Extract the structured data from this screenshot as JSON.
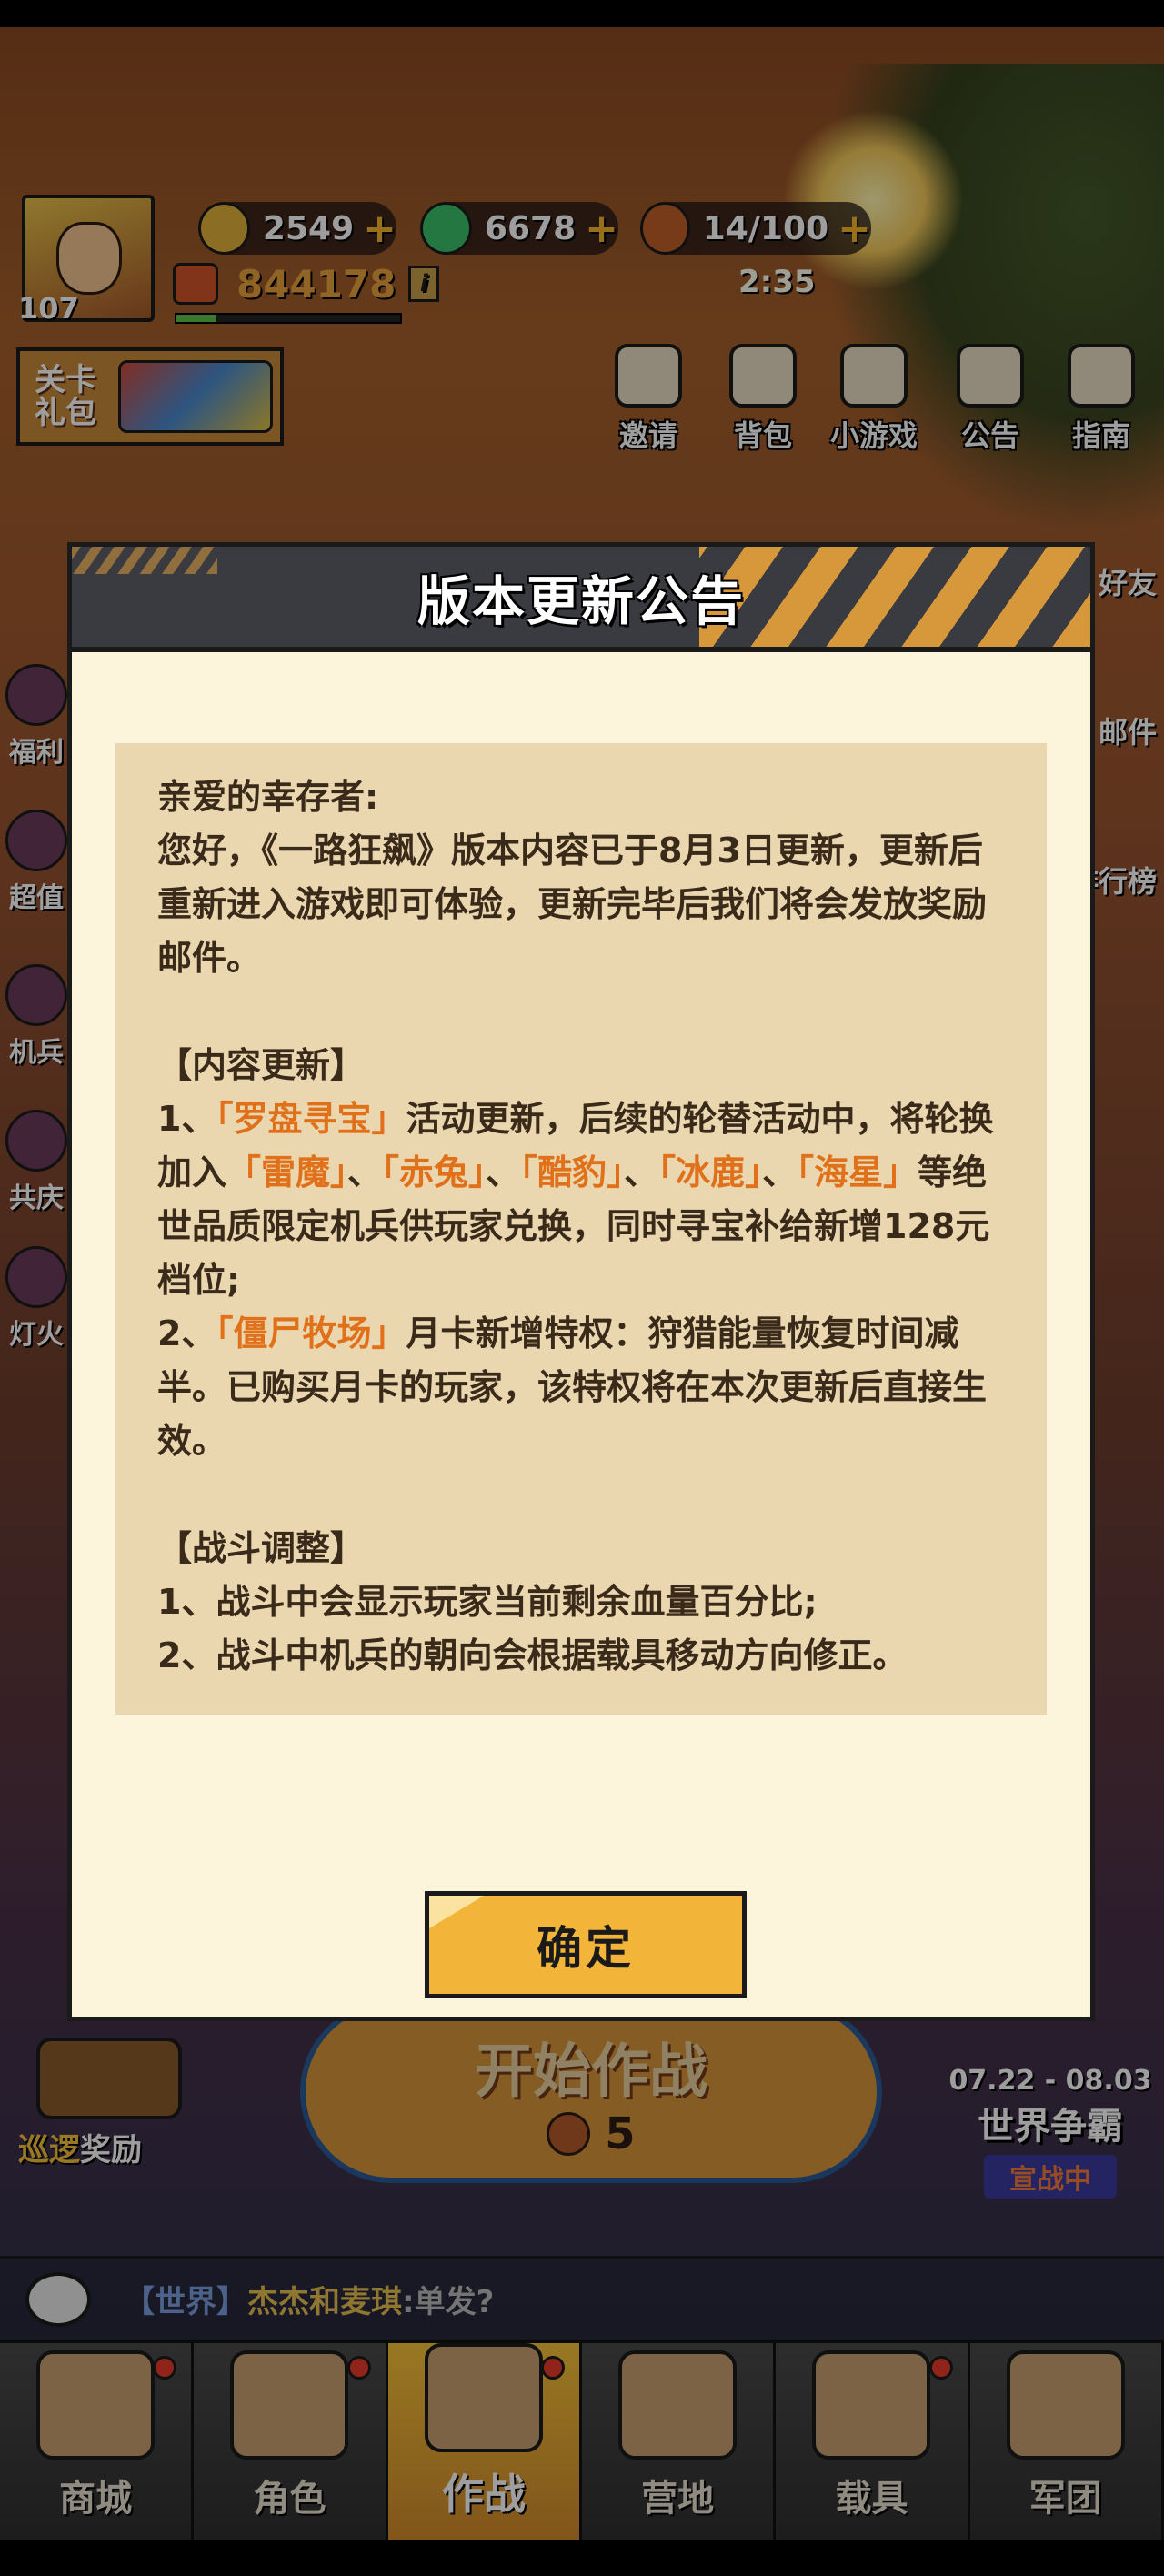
{
  "hud": {
    "level": "107",
    "coins": "2549",
    "gems": "6678",
    "stamina": "14/100",
    "stamina_timer": "2:35",
    "power": "844178",
    "power_info": "i",
    "pack_label": "关卡礼包"
  },
  "top_menu": [
    {
      "label": "邀请"
    },
    {
      "label": "背包"
    },
    {
      "label": "小游戏"
    },
    {
      "label": "公告"
    },
    {
      "label": "指南"
    }
  ],
  "side_left": [
    {
      "label": "福利"
    },
    {
      "label": "超值"
    },
    {
      "label": "机兵"
    },
    {
      "label": "共庆"
    },
    {
      "label": "灯火"
    }
  ],
  "side_right": [
    {
      "label": "好友"
    },
    {
      "label": "邮件"
    },
    {
      "label": "排行榜"
    }
  ],
  "start": {
    "label": "开始作战",
    "cost": "5"
  },
  "patrol": {
    "label": "巡逻",
    "label_sub": "奖励"
  },
  "world_event": {
    "date_range": "07.22 - 08.03",
    "title": "世界争霸",
    "status": "宣战中"
  },
  "chat": {
    "channel": "【世界】",
    "name": "杰杰和麦琪",
    "message": ":单发?"
  },
  "nav": [
    {
      "label": "商城",
      "badge": true
    },
    {
      "label": "角色",
      "badge": true
    },
    {
      "label": "作战",
      "badge": true,
      "active": true
    },
    {
      "label": "营地",
      "badge": false
    },
    {
      "label": "载具",
      "badge": true
    },
    {
      "label": "军团",
      "badge": false
    }
  ],
  "dialog": {
    "title": "版本更新公告",
    "greeting": "亲爱的幸存者:",
    "intro": "您好，《一路狂飙》版本内容已于8月3日更新，更新后重新进入游戏即可体验，更新完毕后我们将会发放奖励邮件。",
    "section1_title": "【内容更新】",
    "item1_prefix": "1、",
    "item1_hl1": "「罗盘寻宝」",
    "item1_text1": "活动更新，后续的轮替活动中，将轮换加入",
    "item1_hl2": "「雷魔」",
    "item1_sep1": "、",
    "item1_hl3": "「赤兔」",
    "item1_sep2": "、",
    "item1_hl4": "「酷豹」",
    "item1_sep3": "、",
    "item1_hl5": "「冰鹿」",
    "item1_sep4": "、",
    "item1_hl6": "「海星」",
    "item1_text2": "等绝世品质限定机兵供玩家兑换，同时寻宝补给新增128元档位;",
    "item2_prefix": "2、",
    "item2_hl1": "「僵尸牧场」",
    "item2_text": "月卡新增特权：狩猎能量恢复时间减半。已购买月卡的玩家，该特权将在本次更新后直接生效。",
    "section2_title": "【战斗调整】",
    "item3": "1、战斗中会显示玩家当前剩余血量百分比;",
    "item4": "2、战斗中机兵的朝向会根据载具移动方向修正。",
    "confirm_label": "确定"
  },
  "colors": {
    "highlight": "#e0701a",
    "dialog_bg": "#fdf4dc",
    "content_bg": "#ead7b0",
    "button": "#f2b53a"
  }
}
